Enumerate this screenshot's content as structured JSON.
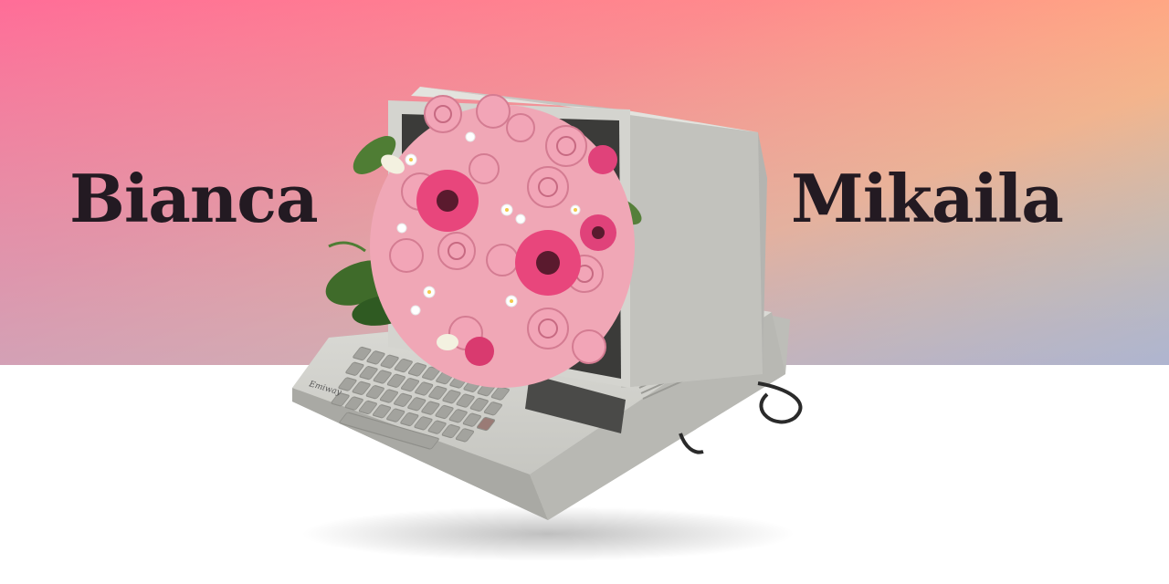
{
  "names": {
    "left": "Bianca",
    "right": "Mikaila"
  },
  "keyboard": {
    "brand": "Emiway"
  },
  "colors": {
    "gradient_start": "#ff6d98",
    "gradient_mid": "#ffb77f",
    "gradient_end": "#aec8c0",
    "text": "#231a22",
    "computer_body": "#d9d9d5",
    "flower_pink": "#e8467c",
    "rose_light": "#f3a8b8"
  },
  "illustration": {
    "subject": "retro-computer-with-flowers"
  }
}
